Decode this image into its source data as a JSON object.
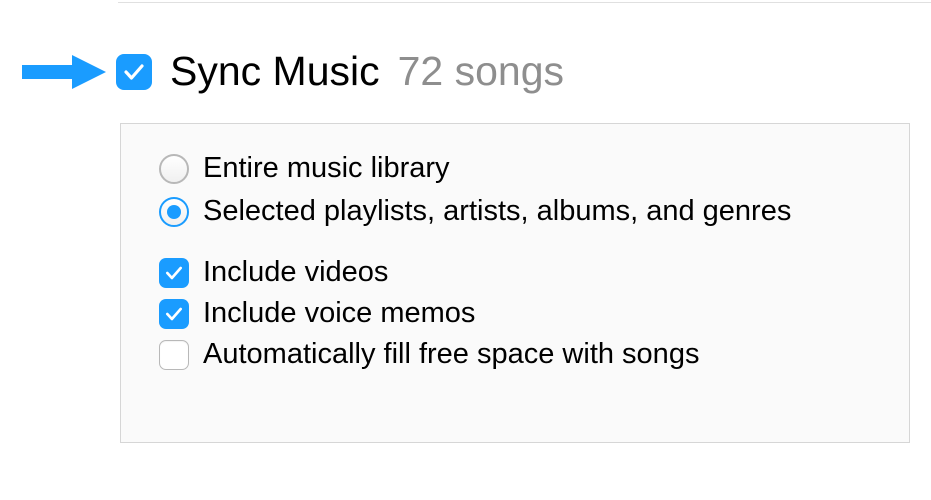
{
  "header": {
    "sync_checked": true,
    "title": "Sync Music",
    "count": "72 songs"
  },
  "radio_options": {
    "entire_library": {
      "label": "Entire music library",
      "selected": false
    },
    "selected_items": {
      "label": "Selected playlists, artists, albums, and genres",
      "selected": true
    }
  },
  "check_options": {
    "include_videos": {
      "label": "Include videos",
      "checked": true
    },
    "include_voice_memos": {
      "label": "Include voice memos",
      "checked": true
    },
    "auto_fill": {
      "label": "Automatically fill free space with songs",
      "checked": false
    }
  }
}
